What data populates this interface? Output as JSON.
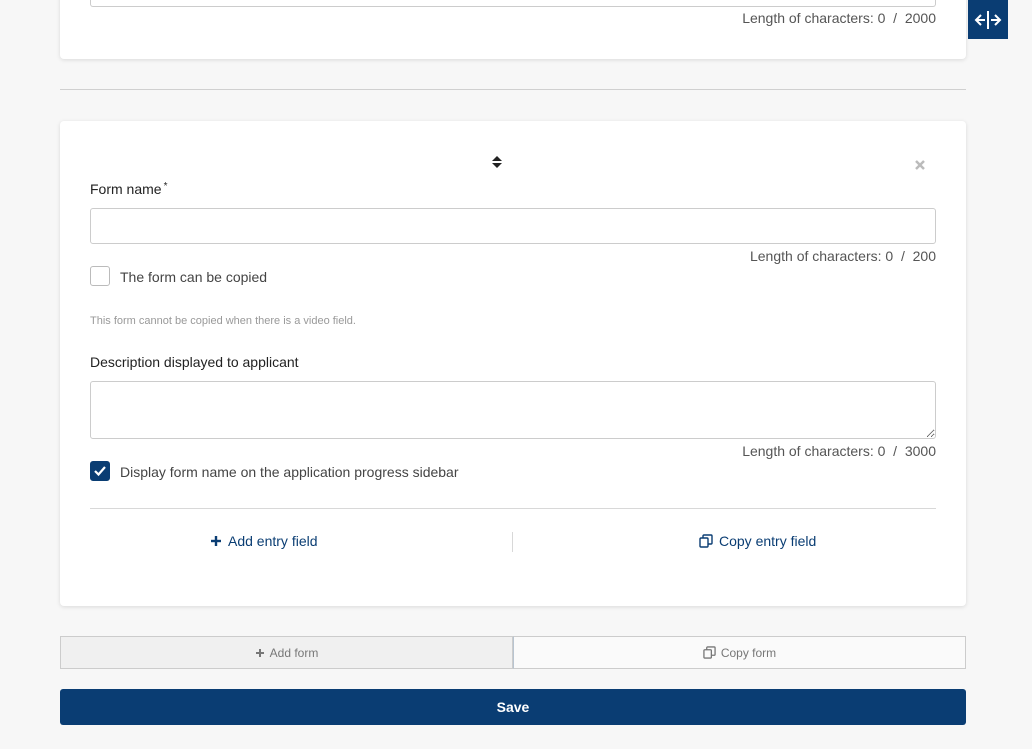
{
  "top_card": {
    "counter_prefix": "Length of characters: 0",
    "counter_sep": "/",
    "counter_max": "2000"
  },
  "form": {
    "name_label": "Form name",
    "required_mark": "*",
    "name_value": "",
    "name_counter_prefix": "Length of characters: 0",
    "name_counter_sep": "/",
    "name_counter_max": "200",
    "copyable_label": "The form can be copied",
    "copyable_checked": false,
    "copy_note": "This form cannot be copied when there is a video field.",
    "description_label": "Description displayed to applicant",
    "description_value": "",
    "description_counter_prefix": "Length of characters: 0",
    "description_counter_sep": "/",
    "description_counter_max": "3000",
    "display_name_label": "Display form name on the application progress sidebar",
    "display_name_checked": true,
    "add_entry_label": "Add entry field",
    "copy_entry_label": "Copy entry field"
  },
  "footer": {
    "add_form_label": "Add form",
    "copy_form_label": "Copy form",
    "save_label": "Save"
  },
  "colors": {
    "primary": "#0a3d73",
    "background": "#f7f7f7"
  },
  "icons": [
    "expand-horizontal-icon",
    "sort-icon",
    "close-icon",
    "check-icon",
    "plus-icon",
    "copy-icon"
  ]
}
